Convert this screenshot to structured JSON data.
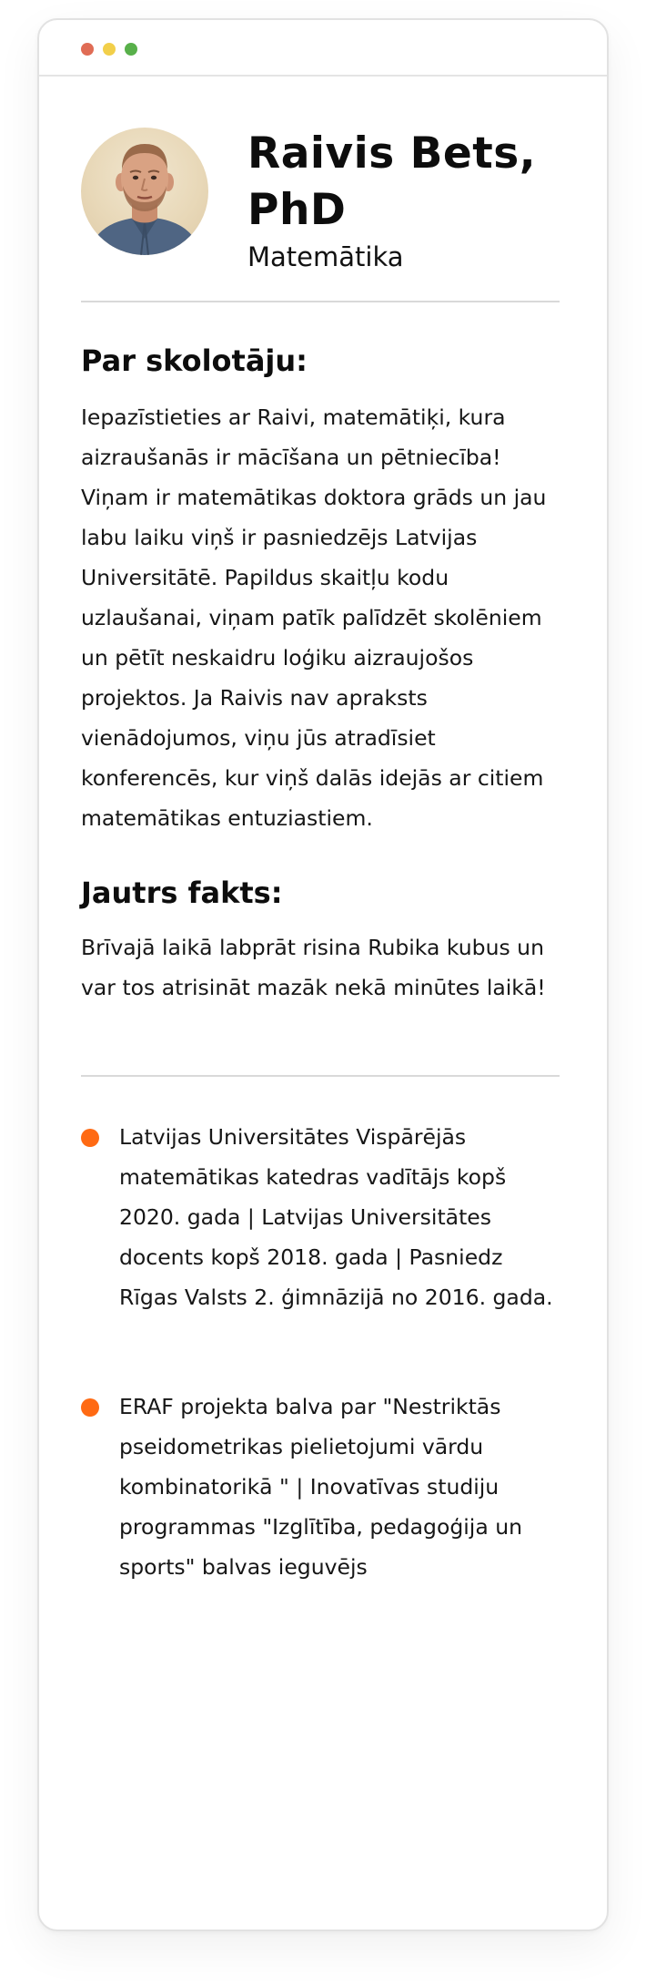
{
  "window": {
    "controls": [
      "close",
      "minimize",
      "maximize"
    ]
  },
  "profile": {
    "name": "Raivis Bets, PhD",
    "subject": "Matemātika",
    "avatar_icon": "teacher-portrait-photo"
  },
  "about": {
    "heading": "Par skolotāju:",
    "text": "Iepazīstieties ar Raivi, matemātiķi, kura aizraušanās ir mācīšana un pētniecība! Viņam ir matemātikas doktora grāds un jau labu laiku viņš ir pasniedzējs Latvijas Universitātē. Papildus skaitļu kodu uzlaušanai, viņam patīk palīdzēt skolēniem un pētīt neskaidru loģiku aizraujošos projektos. Ja Raivis nav apraksts vienādojumos, viņu jūs atradīsiet konferencēs, kur viņš dalās idejās ar citiem matemātikas entuziastiem."
  },
  "fun_fact": {
    "heading": "Jautrs fakts:",
    "text": "Brīvajā laikā labprāt risina Rubika kubus un var tos atrisināt mazāk nekā minūtes laikā!"
  },
  "achievements": [
    "Latvijas Universitātes Vispārējās matemātikas katedras vadītājs kopš 2020. gada | Latvijas Universitātes docents kopš 2018. gada | Pasniedz Rīgas Valsts 2. ģimnāzijā no 2016. gada.",
    "ERAF projekta balva par \"Nestriktās pseidometrikas pielietojumi vārdu kombinatorikā \" | Inovatīvas studiju programmas \"Izglītība, pedagoģija un sports\" balvas ieguvējs"
  ],
  "colors": {
    "accent": "#ff6a13",
    "close_dot": "#e06c55",
    "minimize_dot": "#f2cf4a",
    "maximize_dot": "#58b04a",
    "divider": "#d9d9d9"
  }
}
